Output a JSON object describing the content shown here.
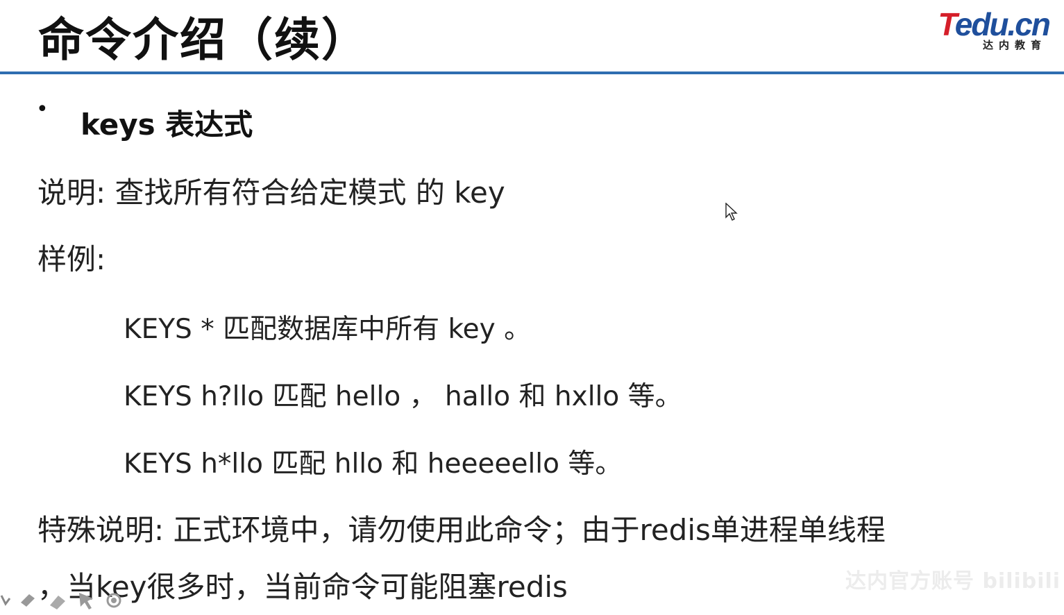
{
  "slide": {
    "title": "命令介绍（续）",
    "logo": {
      "brand_initial": "T",
      "brand_rest": "edu.cn",
      "tagline": "达内教育"
    },
    "bullet_glyph": "•",
    "heading": "keys 表达式",
    "description": "说明:  查找所有符合给定模式 的 key",
    "example_label": "样例:",
    "examples": [
      "KEYS * 匹配数据库中所有 key 。",
      "KEYS h?llo 匹配 hello ，  hallo 和 hxllo 等。",
      "KEYS h*llo 匹配 hllo 和 heeeeello 等。"
    ],
    "note_line1": "特殊说明:  正式环境中，请勿使用此命令；由于redis单进程单线程",
    "note_line2": "，当key很多时，当前命令可能阻塞redis"
  },
  "overlay": {
    "watermark": "达内官方账号 bilibili",
    "annotation_tools": [
      "pen-icon",
      "highlighter-icon",
      "eraser-icon",
      "pointer-icon",
      "record-icon"
    ]
  },
  "colors": {
    "rule": "#2f6db0",
    "logo_red": "#d51f2a",
    "logo_blue": "#1f4f9c"
  }
}
